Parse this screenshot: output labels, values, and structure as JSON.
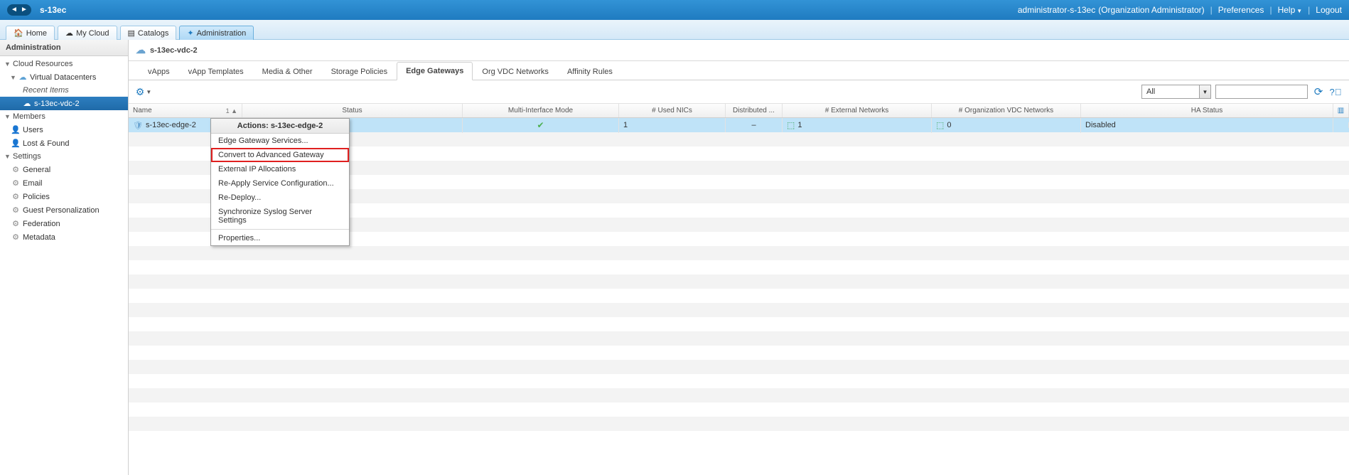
{
  "topbar": {
    "app_title": "s-13ec",
    "user": "administrator-s-13ec",
    "role": "(Organization Administrator)",
    "preferences": "Preferences",
    "help": "Help",
    "logout": "Logout"
  },
  "subtabs": {
    "home": "Home",
    "mycloud": "My Cloud",
    "catalogs": "Catalogs",
    "administration": "Administration"
  },
  "sidebar": {
    "title": "Administration",
    "cloud_resources": "Cloud Resources",
    "vdcs": "Virtual Datacenters",
    "recent": "Recent Items",
    "vdc_item": "s-13ec-vdc-2",
    "members": "Members",
    "users": "Users",
    "lost_found": "Lost & Found",
    "settings": "Settings",
    "general": "General",
    "email": "Email",
    "policies": "Policies",
    "guest_pers": "Guest Personalization",
    "federation": "Federation",
    "metadata": "Metadata"
  },
  "breadcrumb": {
    "title": "s-13ec-vdc-2"
  },
  "inner_tabs": {
    "vapps": "vApps",
    "vapp_tmpl": "vApp Templates",
    "media": "Media & Other",
    "storage": "Storage Policies",
    "edge": "Edge Gateways",
    "orgvdc": "Org VDC Networks",
    "affinity": "Affinity Rules"
  },
  "toolbar": {
    "filter_all": "All"
  },
  "grid": {
    "headers": {
      "name": "Name",
      "sort": "1 ▲",
      "status": "Status",
      "mim": "Multi-Interface Mode",
      "nics": "# Used NICs",
      "dist": "Distributed ...",
      "ext": "# External Networks",
      "orgnets": "# Organization VDC Networks",
      "ha": "HA Status"
    },
    "rows": [
      {
        "name": "s-13ec-edge-2",
        "nics": "1",
        "dist": "–",
        "ext": "1",
        "orgnets": "0",
        "ha": "Disabled"
      }
    ]
  },
  "ctx": {
    "title": "Actions: s-13ec-edge-2",
    "svc": "Edge Gateway Services...",
    "convert": "Convert to Advanced Gateway",
    "extip": "External IP Allocations",
    "reapply": "Re-Apply Service Configuration...",
    "redeploy": "Re-Deploy...",
    "sync": "Synchronize Syslog Server Settings",
    "props": "Properties..."
  }
}
